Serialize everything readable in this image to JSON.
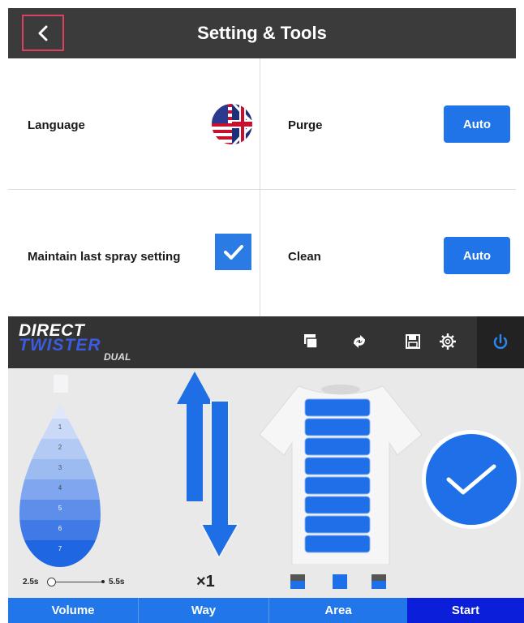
{
  "header": {
    "title": "Setting & Tools"
  },
  "settings": {
    "language_label": "Language",
    "purge_label": "Purge",
    "purge_value": "Auto",
    "maintain_label": "Maintain last spray setting",
    "maintain_checked": true,
    "clean_label": "Clean",
    "clean_value": "Auto"
  },
  "app": {
    "logo": {
      "line1": "DIRECT",
      "line2": "TWISTER",
      "line3": "DUAL"
    },
    "header_icons": [
      "copy-icon",
      "swap-icon",
      "save-icon",
      "gear-icon",
      "power-icon"
    ],
    "drop_levels": [
      "1",
      "2",
      "3",
      "4",
      "5",
      "6",
      "7"
    ],
    "timing_min": "2.5s",
    "timing_max": "5.5s",
    "multiplier": "×1",
    "tabs": {
      "volume": "Volume",
      "way": "Way",
      "area": "Area",
      "start": "Start"
    }
  },
  "colors": {
    "accent": "#2074e8",
    "start_tab": "#0b1ed9",
    "header_bg": "#3b3b3b",
    "back_border": "#d9415e"
  }
}
